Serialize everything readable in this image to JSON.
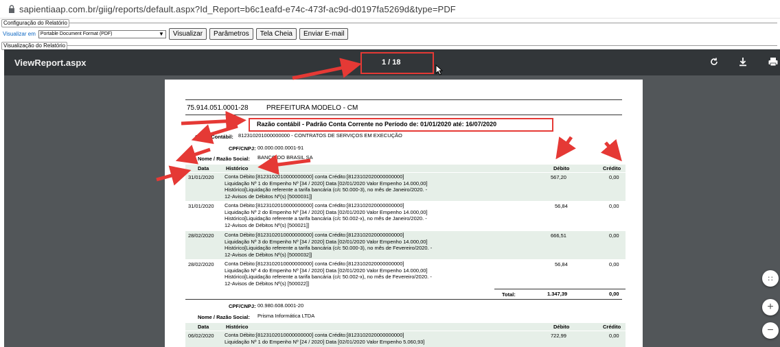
{
  "browser": {
    "url": "sapientiaap.com.br/giig/reports/default.aspx?Id_Report=b6c1eafd-e74c-473f-ac9d-d0197fa5269d&type=PDF"
  },
  "config": {
    "legend": "Configuração do Relatório",
    "visualizar_label": "Visualizar em",
    "format_value": "Portable Document Format (PDF)",
    "buttons": [
      "Visualizar",
      "Parâmetros",
      "Tela Cheia",
      "Enviar E-mail"
    ]
  },
  "view": {
    "legend": "Visualização do Relatório"
  },
  "viewer": {
    "title": "ViewReport.aspx",
    "page_indicator": "1 / 18"
  },
  "report": {
    "cnpj": "75.914.051.0001-28",
    "org": "PREFEITURA MODELO - CM",
    "title": "Razão contábil - Padrão Conta Corrente no Período de: 01/01/2020 até: 16/07/2020",
    "conta_label": "Conta Contábil:",
    "conta_value": "812310201000000000 - CONTRATOS DE SERVIÇOS EM EXECUÇÃO",
    "cpf_label": "CPF/CNPJ:",
    "nome_label": "Nome / Razão Social:",
    "columns": {
      "data": "Data",
      "historico": "Histórico",
      "debito": "Débito",
      "credito": "Crédito"
    },
    "groups": [
      {
        "cpf": "00.000.000.0001-91",
        "nome": "BANCO DO BRASIL SA",
        "rows": [
          {
            "data": "31/01/2020",
            "lines": [
              "Conta Débito:[8123102010000000000] conta Crédito:[8123102020000000000]",
              " Liquidação Nº 1 do Empenho Nº [34 / 2020] Data [02/01/2020 Valor Empenho 14.000,00]",
              "Histórico[Liquidação referente a tarifa bancária (c/c 50.000-3), no mês de Janeiro/2020. -",
              "12-Avisos de Débitos Nº(s) [5000031]]"
            ],
            "debito": "567,20",
            "credito": "0,00"
          },
          {
            "data": "31/01/2020",
            "lines": [
              "Conta Débito:[8123102010000000000] conta Crédito:[8123102020000000000]",
              " Liquidação Nº 2 do Empenho Nº [34 / 2020] Data [02/01/2020 Valor Empenho 14.000,00]",
              "Histórico[Liquidação  referente a tarifa bancária (c/c 50.002-x), no mês de Janeiro/2020. -",
              "12-Avisos de Débitos Nº(s) [500021]]"
            ],
            "debito": "56,84",
            "credito": "0,00"
          },
          {
            "data": "28/02/2020",
            "lines": [
              "Conta Débito:[8123102010000000000] conta Crédito:[8123102020000000000]",
              " Liquidação Nº 3 do Empenho Nº [34 / 2020] Data [02/01/2020 Valor Empenho 14.000,00]",
              "Histórico[Liquidação referente a tarifa bancária (c/c 50.000-3), no mês de Fevereiro/2020. -",
              "12-Avisos de Débitos Nº(s) [5000032]]"
            ],
            "debito": "666,51",
            "credito": "0,00"
          },
          {
            "data": "28/02/2020",
            "lines": [
              "Conta Débito:[8123102010000000000] conta Crédito:[8123102020000000000]",
              " Liquidação Nº 4 do Empenho Nº [34 / 2020] Data [02/01/2020 Valor Empenho 14.000,00]",
              "Histórico[Liquidação referente a tarifa bancária (c/c 50.002-x), no mês de Fevereiro/2020. -",
              "12-Avisos de Débitos Nº(s) [500022]]"
            ],
            "debito": "56,84",
            "credito": "0,00"
          }
        ],
        "total_label": "Total:",
        "total_debito": "1.347,39",
        "total_credito": "0,00"
      },
      {
        "cpf": "00.980.608.0001-20",
        "nome": "Prisma Informática LTDA",
        "rows": [
          {
            "data": "06/02/2020",
            "lines": [
              "Conta Débito:[8123102010000000000] conta Crédito:[8123102020000000000]",
              " Liquidação Nº 1 do Empenho Nº [24 / 2020] Data [02/01/2020 Valor Empenho 5.060,93]"
            ],
            "debito": "722,99",
            "credito": "0,00"
          }
        ]
      }
    ]
  }
}
